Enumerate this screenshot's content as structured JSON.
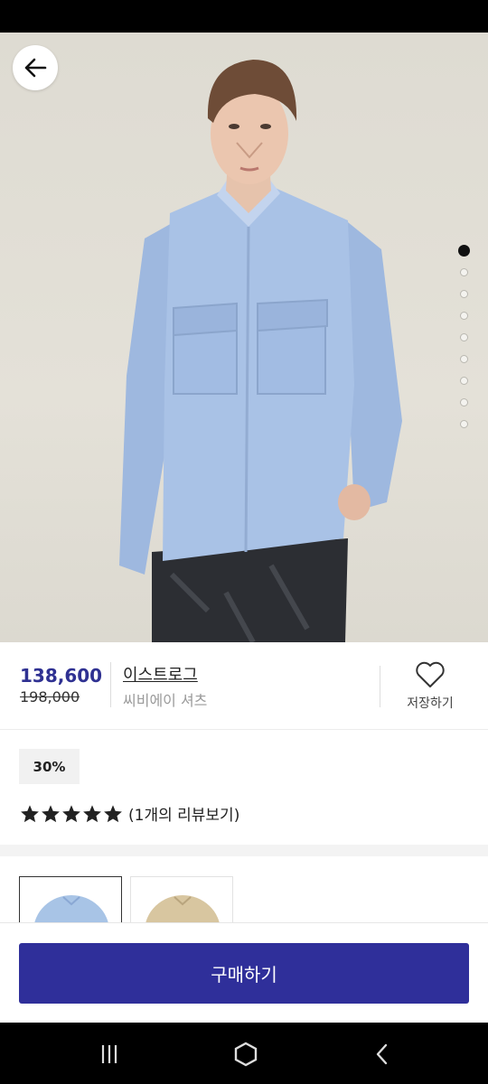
{
  "product": {
    "price": "138,600",
    "original_price": "198,000",
    "brand": "이스트로그",
    "name": "씨비에이 셔츠",
    "save_label": "저장하기",
    "discount": "30%",
    "review_link": "(1개의 리뷰보기)",
    "rating": 5,
    "image_slides": 9,
    "active_slide": 1
  },
  "thumbnails": [
    {
      "color": "#a8c4e6",
      "selected": true
    },
    {
      "color": "#d8c6a0",
      "selected": false
    }
  ],
  "buy_label": "구매하기",
  "colors": {
    "accent": "#2f2f9a",
    "price": "#2f3192"
  },
  "icons": [
    "back-arrow-icon",
    "heart-icon",
    "star-icon",
    "recent-apps-icon",
    "home-icon",
    "back-nav-icon"
  ]
}
